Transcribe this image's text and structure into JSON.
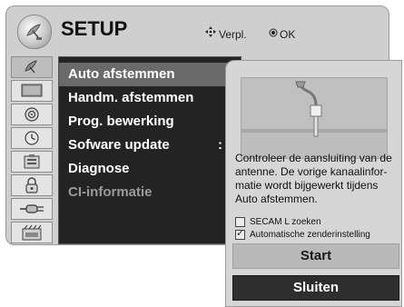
{
  "header": {
    "title": "SETUP",
    "icon": "satellite-dish-icon",
    "hint_move": "Verpl.",
    "hint_ok": "OK"
  },
  "sidebar": {
    "items": [
      {
        "icon": "satellite-dish-icon",
        "active": true
      },
      {
        "icon": "tv-picture-icon",
        "active": false
      },
      {
        "icon": "speaker-audio-icon",
        "active": false
      },
      {
        "icon": "clock-time-icon",
        "active": false
      },
      {
        "icon": "lock-option-icon",
        "active": false
      },
      {
        "icon": "padlock-icon",
        "active": false
      },
      {
        "icon": "input-plug-icon",
        "active": false
      },
      {
        "icon": "usb-media-icon",
        "active": false
      }
    ]
  },
  "menu": {
    "items": [
      {
        "label": "Auto afstemmen",
        "state": "selected"
      },
      {
        "label": "Handm. afstemmen",
        "state": "normal"
      },
      {
        "label": "Prog. bewerking",
        "state": "normal"
      },
      {
        "label": "Sofware update",
        "state": "normal",
        "value": ": A"
      },
      {
        "label": "Diagnose",
        "state": "normal"
      },
      {
        "label": "CI-informatie",
        "state": "disabled"
      }
    ]
  },
  "popup": {
    "illustration_icon": "antenna-cable-icon",
    "description": "Controleer de aansluiting van de antenne. De vorige kanaalinfor-matie wordt bijgewerkt tijdens Auto afstemmen.",
    "options": [
      {
        "label": "SECAM L zoeken",
        "checked": false
      },
      {
        "label": "Automatische zenderinstelling",
        "checked": true
      }
    ],
    "start_label": "Start",
    "close_label": "Sluiten"
  }
}
